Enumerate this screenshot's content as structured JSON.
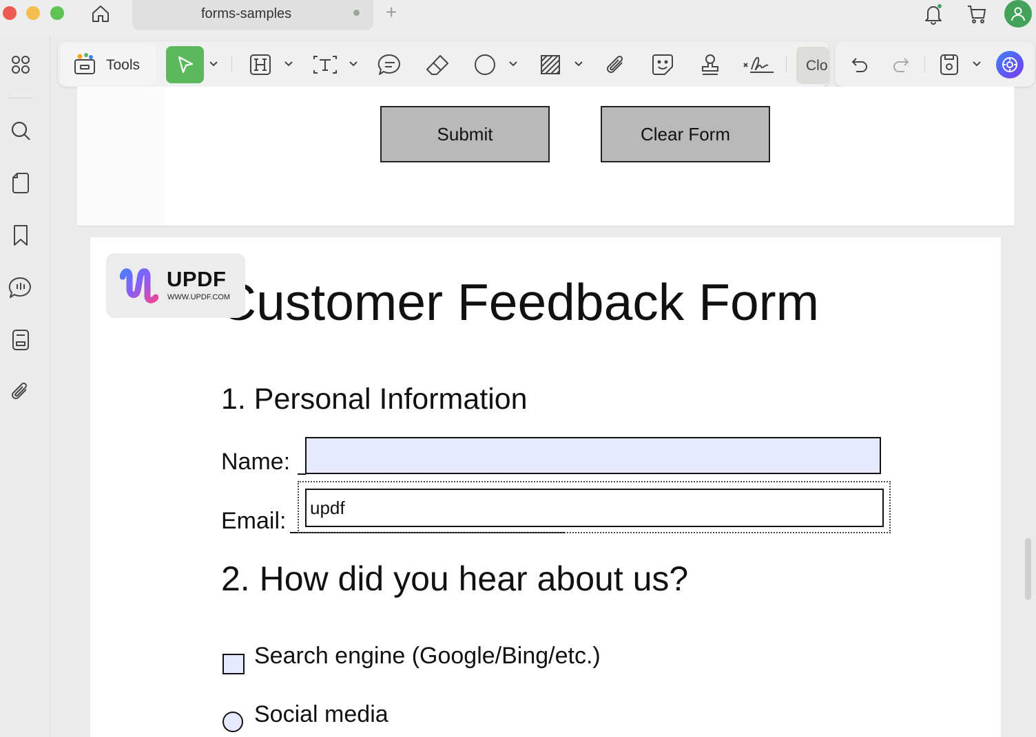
{
  "window": {
    "tab_title": "forms-samples"
  },
  "toolbar": {
    "tools_label": "Tools",
    "clo_label": "Clo"
  },
  "document": {
    "submit_label": "Submit",
    "clear_label": "Clear Form",
    "logo_name": "UPDF",
    "logo_url": "WWW.UPDF.COM",
    "title": "Customer Feedback Form",
    "section1_title": "1. Personal Information",
    "name_label": "Name:",
    "name_value": "",
    "email_label": "Email:",
    "email_value": "updf",
    "section2_title": "2. How did you hear about us?",
    "options": [
      {
        "label": "Search engine (Google/Bing/etc.)",
        "control": "checkbox"
      },
      {
        "label": "Social media",
        "control": "radio"
      }
    ]
  },
  "colors": {
    "accent_green": "#5cb85c",
    "field_fill": "#e6e9ff",
    "pdf_button_fill": "#b9b9b9",
    "avatar_green": "#43a35a"
  },
  "icons": {
    "titlebar": [
      "home-icon",
      "plus-icon",
      "bell-icon",
      "cart-icon",
      "user-icon"
    ],
    "rail": [
      "grid-icon",
      "search-icon",
      "page-icon",
      "bookmark-icon",
      "comment-icon",
      "form-icon",
      "attachment-icon"
    ],
    "toolbar": [
      "toolbox-icon",
      "select-cursor-icon",
      "heading-icon",
      "text-box-icon",
      "comment-bubble-icon",
      "eraser-icon",
      "circle-shape-icon",
      "hatch-area-icon",
      "paperclip-icon",
      "sticker-icon",
      "stamp-icon",
      "signature-icon",
      "undo-icon",
      "redo-icon",
      "save-icon",
      "ai-assistant-icon"
    ]
  }
}
